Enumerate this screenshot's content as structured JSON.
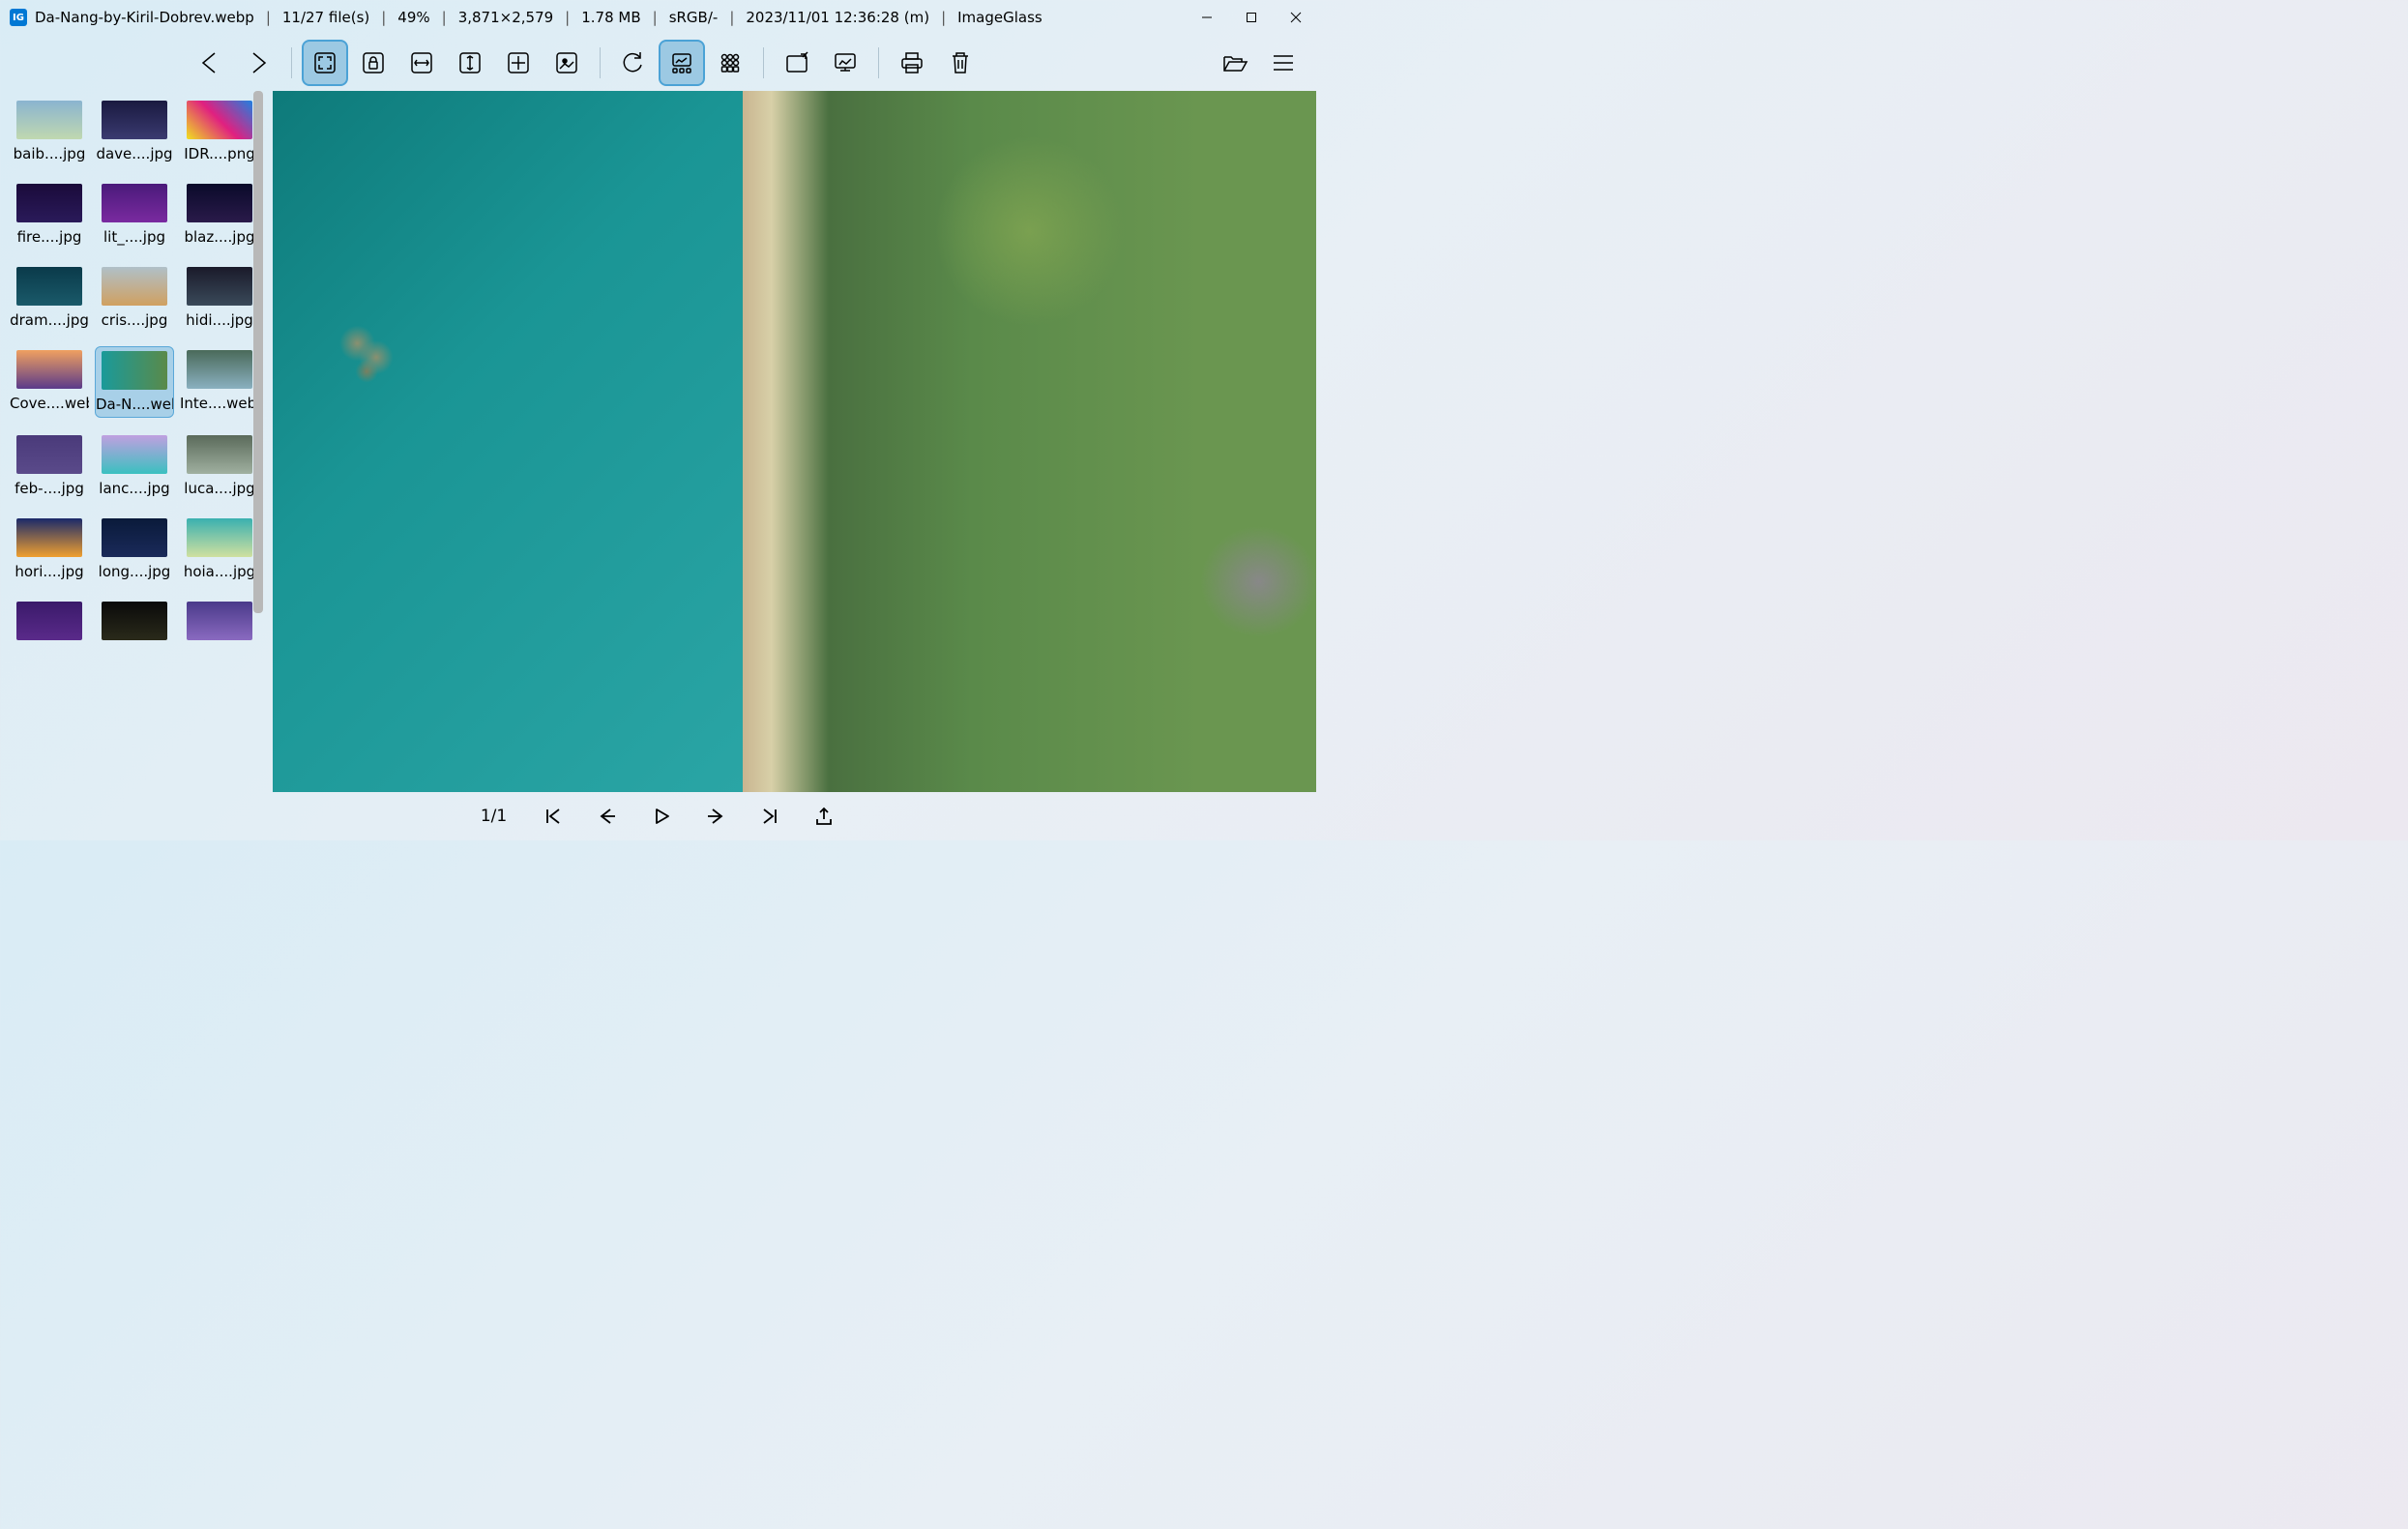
{
  "title": {
    "filename": "Da-Nang-by-Kiril-Dobrev.webp",
    "position": "11/27 file(s)",
    "zoom": "49%",
    "dimensions": "3,871×2,579",
    "filesize": "1.78 MB",
    "colorspace": "sRGB/-",
    "datetime": "2023/11/01 12:36:28 (m)",
    "appname": "ImageGlass"
  },
  "gallery": [
    {
      "label": "baib....jpg",
      "thumb_bg": "linear-gradient(#8ab4d0,#c0d8b0)"
    },
    {
      "label": "dave....jpg",
      "thumb_bg": "linear-gradient(#1a1a40,#3a3a70)"
    },
    {
      "label": "IDR....png",
      "thumb_bg": "linear-gradient(45deg,#f0e020,#e02080,#2080e0)"
    },
    {
      "label": "fire....jpg",
      "thumb_bg": "linear-gradient(#1a0a3a,#2a1a5a)"
    },
    {
      "label": "lit_....jpg",
      "thumb_bg": "linear-gradient(#4a1a7a,#7a2aa0)"
    },
    {
      "label": "blaz....jpg",
      "thumb_bg": "linear-gradient(#0a0a2a,#2a1a4a)"
    },
    {
      "label": "dram....jpg",
      "thumb_bg": "linear-gradient(#0a3a4a,#1a5a6a)"
    },
    {
      "label": "cris....jpg",
      "thumb_bg": "linear-gradient(#b0c0c8,#d0a060)"
    },
    {
      "label": "hidi....jpg",
      "thumb_bg": "linear-gradient(#1a1a2a,#3a4a5a)"
    },
    {
      "label": "Cove....webp",
      "thumb_bg": "linear-gradient(#f0a060,#5a3a8a)"
    },
    {
      "label": "Da-N....webp",
      "thumb_bg": "linear-gradient(90deg,#1a9a9a,#5a8a4a)",
      "selected": true
    },
    {
      "label": "Inte....webp",
      "thumb_bg": "linear-gradient(#4a6a5a,#8ab0c0)"
    },
    {
      "label": "feb-....jpg",
      "thumb_bg": "linear-gradient(#4a3a7a,#5a4a8a)"
    },
    {
      "label": "lanc....jpg",
      "thumb_bg": "linear-gradient(#c0a0e0,#3ac0c0)"
    },
    {
      "label": "luca....jpg",
      "thumb_bg": "linear-gradient(#5a6a5a,#a0b0a0)"
    },
    {
      "label": "hori....jpg",
      "thumb_bg": "linear-gradient(#1a2a6a,#f0a030)"
    },
    {
      "label": "long....jpg",
      "thumb_bg": "linear-gradient(#0a1a3a,#1a2a5a)"
    },
    {
      "label": "hoia....jpg",
      "thumb_bg": "linear-gradient(#3ab0b0,#d0e0a0)"
    },
    {
      "label": "",
      "thumb_bg": "linear-gradient(#3a1a6a,#5a2a8a)"
    },
    {
      "label": "",
      "thumb_bg": "linear-gradient(#0a0a0a,#2a2a1a)"
    },
    {
      "label": "",
      "thumb_bg": "linear-gradient(#4a3a8a,#8a6ac0)"
    }
  ],
  "status": {
    "page": "1/1"
  }
}
